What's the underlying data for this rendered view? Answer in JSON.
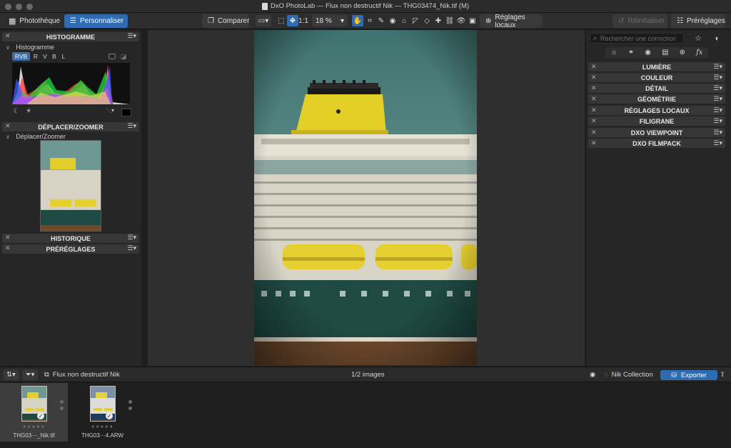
{
  "window": {
    "title": "DxO PhotoLab — Flux non destructif Nik — THG03474_Nik.tif (M)"
  },
  "toolbar": {
    "tab_phototheque": "Photothèque",
    "tab_personnaliser": "Personnaliser",
    "compare_label": "Comparer",
    "ratio_label": "1:1",
    "zoom_value": "18 %",
    "local_adjust_label": "Réglages locaux",
    "reset_label": "Réinitialiser",
    "presets_label": "Préréglages"
  },
  "left_panel": {
    "histogram_title": "HISTOGRAMME",
    "histogram_sub": "Histogramme",
    "channels": [
      "RVB",
      "R",
      "V",
      "B",
      "L"
    ],
    "active_channel": "RVB",
    "move_zoom_title": "DÉPLACER/ZOOMER",
    "move_zoom_sub": "Déplacer/Zoomer",
    "history_title": "HISTORIQUE",
    "presets_title": "PRÉRÉGLAGES"
  },
  "right_panel": {
    "search_placeholder": "Rechercher une correction",
    "sections": [
      "LUMIÈRE",
      "COULEUR",
      "DÉTAIL",
      "GÉOMÉTRIE",
      "RÉGLAGES LOCAUX",
      "FILIGRANE",
      "DXO VIEWPOINT",
      "DXO FILMPACK"
    ]
  },
  "filmstrip_bar": {
    "project_label": "Flux non destructif Nik",
    "count_label": "1/2 images",
    "nik_label": "Nik Collection",
    "export_label": "Exporter"
  },
  "filmstrip": {
    "items": [
      {
        "name": "THG03···_Nik.tif",
        "stars": "★★★★★",
        "selected": true
      },
      {
        "name": "THG03···4.ARW",
        "stars": "★★★★★",
        "selected": false
      }
    ]
  },
  "colors": {
    "accent": "#2e6bb0",
    "funnel_yellow": "#e3cf28",
    "hull_green": "#1f4a44",
    "sky": "#6f9c98"
  },
  "icons": [
    "grid-icon",
    "sliders-icon",
    "compare-icon",
    "hand-icon",
    "crop-icon",
    "eyedropper-icon",
    "eye-icon",
    "sun-icon",
    "star-icon",
    "toggle-icon",
    "export-icon",
    "filter-icon",
    "sort-icon",
    "moon-icon"
  ]
}
